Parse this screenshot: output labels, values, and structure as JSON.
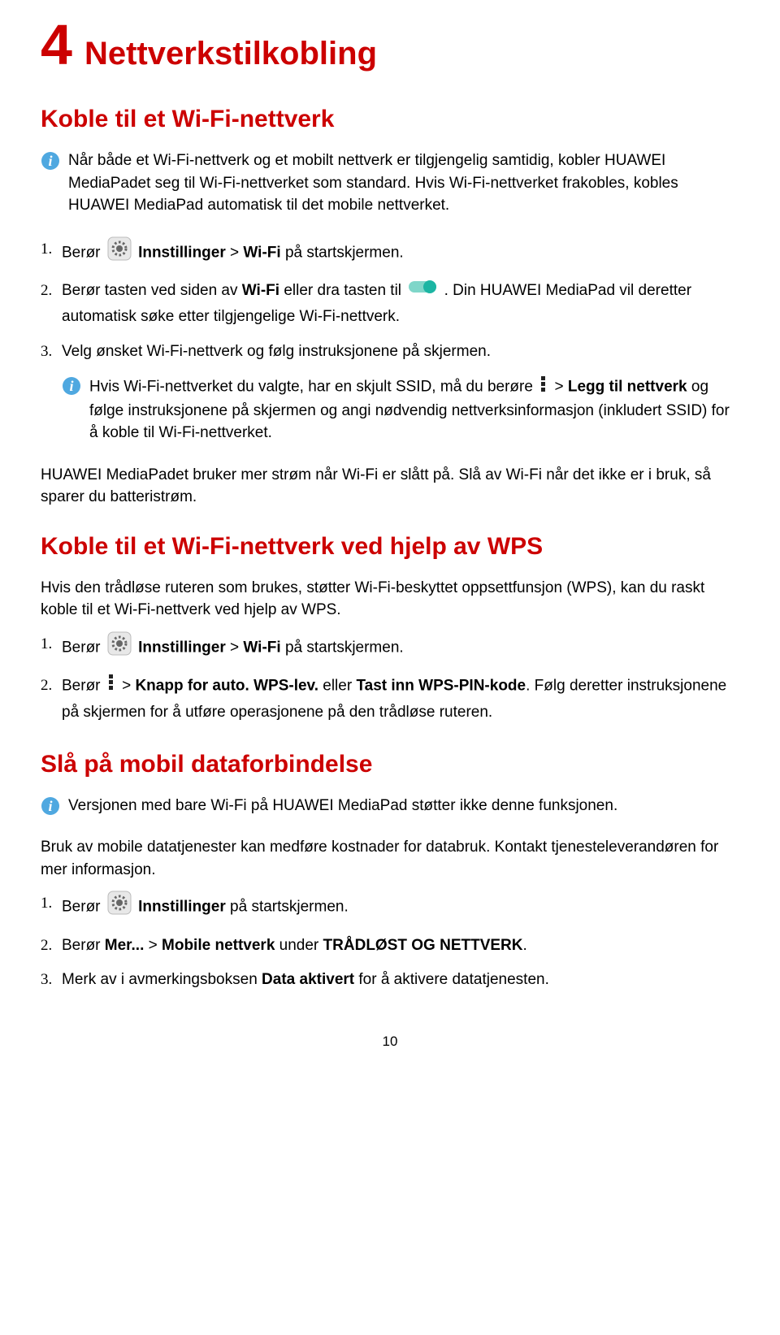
{
  "chapter": {
    "num": "4",
    "title": "Nettverkstilkobling"
  },
  "s1": {
    "heading": "Koble til et Wi-Fi-nettverk",
    "note1": "Når både et Wi-Fi-nettverk og et mobilt nettverk er tilgjengelig samtidig, kobler HUAWEI MediaPadet seg til Wi-Fi-nettverket som standard. Hvis Wi-Fi-nettverket frakobles, kobles HUAWEI MediaPad automatisk til det mobile nettverket.",
    "step1a": "Berør ",
    "step1b": "Innstillinger",
    "step1c": " > ",
    "step1d": "Wi-Fi",
    "step1e": " på startskjermen.",
    "step2a": "Berør tasten ved siden av ",
    "step2b": "Wi-Fi",
    "step2c": " eller dra tasten til ",
    "step2d": ". Din HUAWEI MediaPad vil deretter automatisk søke etter tilgjengelige Wi-Fi-nettverk.",
    "step3": "Velg ønsket Wi-Fi-nettverk og følg instruksjonene på skjermen.",
    "note2a": "Hvis Wi-Fi-nettverket du valgte, har en skjult SSID, må du berøre ",
    "note2b": " > ",
    "note2c": "Legg til nettverk",
    "note2d": " og følge instruksjonene på skjermen og angi nødvendig nettverksinformasjon (inkludert SSID) for å koble til Wi-Fi-nettverket.",
    "p_after": "HUAWEI MediaPadet bruker mer strøm når Wi-Fi er slått på. Slå av Wi-Fi når det ikke er i bruk, så sparer du batteristrøm."
  },
  "s2": {
    "heading": "Koble til et Wi-Fi-nettverk ved hjelp av WPS",
    "p1": "Hvis den trådløse ruteren som brukes, støtter Wi-Fi-beskyttet oppsettfunsjon (WPS), kan du raskt koble til et Wi-Fi-nettverk ved hjelp av WPS.",
    "step1a": "Berør ",
    "step1b": "Innstillinger",
    "step1c": " > ",
    "step1d": "Wi-Fi",
    "step1e": " på startskjermen.",
    "step2a": "Berør ",
    "step2b": " > ",
    "step2c": "Knapp for auto. WPS-lev.",
    "step2d": " eller ",
    "step2e": "Tast inn WPS-PIN-kode",
    "step2f": ". Følg deretter instruksjonene på skjermen for å utføre operasjonene på den trådløse ruteren."
  },
  "s3": {
    "heading": "Slå på mobil dataforbindelse",
    "note1": "Versjonen med bare Wi-Fi på HUAWEI MediaPad støtter ikke denne funksjonen.",
    "p1": "Bruk av mobile datatjenester kan medføre kostnader for databruk. Kontakt tjenesteleverandøren for mer informasjon.",
    "step1a": "Berør ",
    "step1b": "Innstillinger",
    "step1c": " på startskjermen.",
    "step2a": "Berør ",
    "step2b": "Mer...",
    "step2c": " > ",
    "step2d": "Mobile nettverk",
    "step2e": " under ",
    "step2f": "TRÅDLØST OG NETTVERK",
    "step2g": ".",
    "step3a": "Merk av i avmerkingsboksen ",
    "step3b": "Data aktivert",
    "step3c": " for å aktivere datatjenesten."
  },
  "pagenum": "10"
}
